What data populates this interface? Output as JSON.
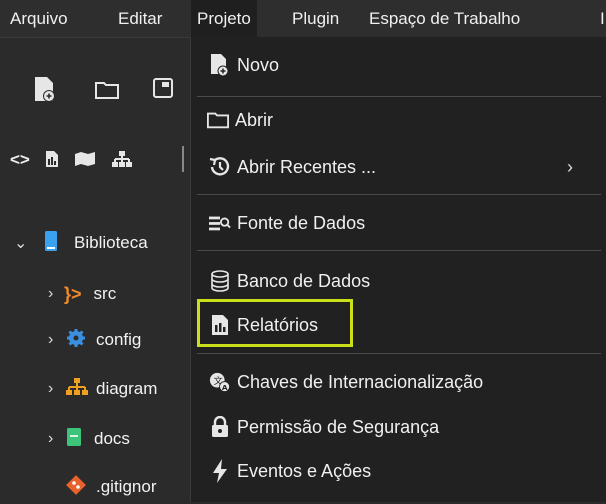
{
  "menubar": {
    "items": [
      "Arquivo",
      "Editar",
      "Projeto",
      "Plugin",
      "Espaço de Trabalho",
      "I"
    ],
    "active": "Projeto"
  },
  "tree": {
    "items": [
      {
        "label": "Biblioteca",
        "icon": "book-icon"
      },
      {
        "label": "src",
        "icon": "code-brackets-icon"
      },
      {
        "label": "config",
        "icon": "gear-icon"
      },
      {
        "label": "diagram",
        "icon": "hierarchy-icon"
      },
      {
        "label": "docs",
        "icon": "document-icon"
      },
      {
        "label": ".gitignor",
        "icon": "git-icon"
      }
    ]
  },
  "dropdown": {
    "items": [
      {
        "label": "Novo",
        "icon": "new-project-icon"
      },
      {
        "label": "Abrir",
        "icon": "folder-icon"
      },
      {
        "label": "Abrir Recentes ...",
        "icon": "history-icon"
      },
      {
        "label": "Fonte de Dados",
        "icon": "data-source-icon"
      },
      {
        "label": "Banco de Dados",
        "icon": "database-icon"
      },
      {
        "label": "Relatórios",
        "icon": "report-icon"
      },
      {
        "label": "Chaves de Internacionalização",
        "icon": "translate-icon"
      },
      {
        "label": "Permissão de Segurança",
        "icon": "lock-icon"
      },
      {
        "label": "Eventos e Ações",
        "icon": "lightning-icon"
      }
    ],
    "submenu_arrow": "›"
  },
  "colors": {
    "highlight": "#c8df1a",
    "menubar_bg": "#2e2e2e",
    "dropdown_bg": "#212121"
  }
}
